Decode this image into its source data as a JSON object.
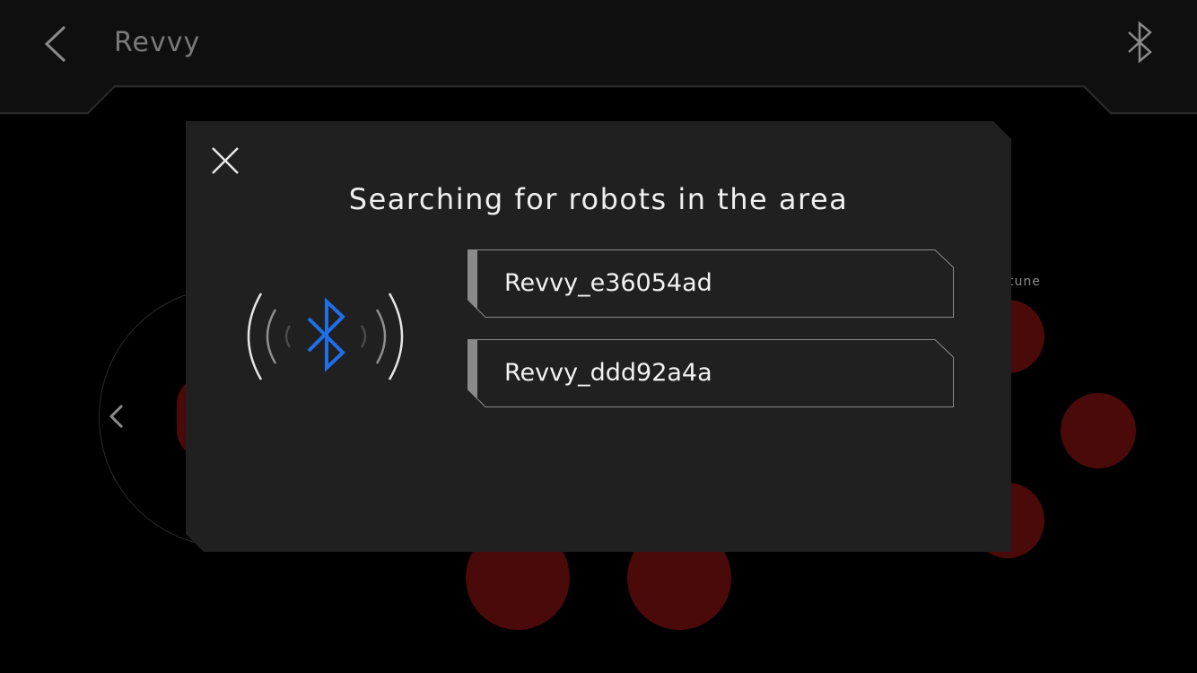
{
  "header": {
    "title": "Revvy",
    "back_icon": "chevron-left-icon",
    "bluetooth_icon": "bluetooth-icon"
  },
  "background": {
    "tune_label": "tune",
    "accent_color": "#4a0a0a"
  },
  "dialog": {
    "title": "Searching for robots in the area",
    "close_icon": "close-icon",
    "bluetooth_color": "#1e6fe8",
    "robots": [
      {
        "name": "Revvy_e36054ad"
      },
      {
        "name": "Revvy_ddd92a4a"
      }
    ]
  }
}
